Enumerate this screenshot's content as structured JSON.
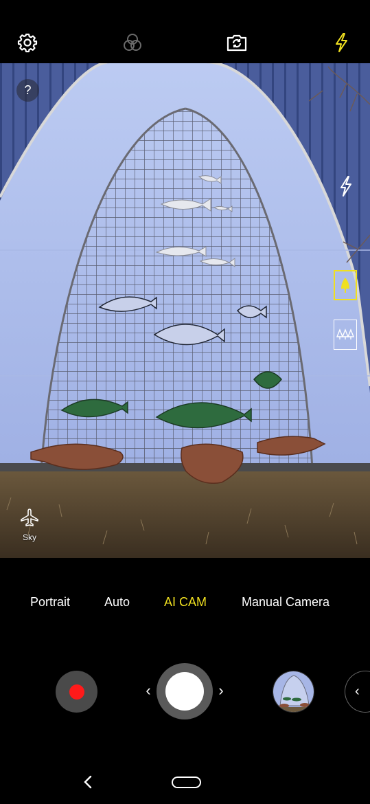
{
  "top_bar": {
    "settings_icon": "gear-icon",
    "filter_icon": "filter-circles-icon",
    "switch_camera_icon": "camera-switch-icon",
    "flash_icon": "flash-icon",
    "flash_color": "#f0e020"
  },
  "viewfinder": {
    "help_label": "?",
    "side_flash_icon": "flash-icon",
    "scene_options": [
      {
        "icon": "tree-icon",
        "selected": true
      },
      {
        "icon": "forest-icon",
        "selected": false
      }
    ],
    "detected_scene": {
      "icon": "airplane-icon",
      "label": "Sky"
    }
  },
  "modes": [
    {
      "label": "Portrait",
      "active": false
    },
    {
      "label": "Auto",
      "active": false
    },
    {
      "label": "AI CAM",
      "active": true
    },
    {
      "label": "Manual Camera",
      "active": false
    }
  ],
  "controls": {
    "record_icon": "record-icon",
    "shutter_icon": "shutter-icon",
    "prev_label": "‹",
    "next_label": "›",
    "drawer_label": "‹"
  },
  "colors": {
    "accent": "#f0e020",
    "record": "#ff1a1a"
  }
}
